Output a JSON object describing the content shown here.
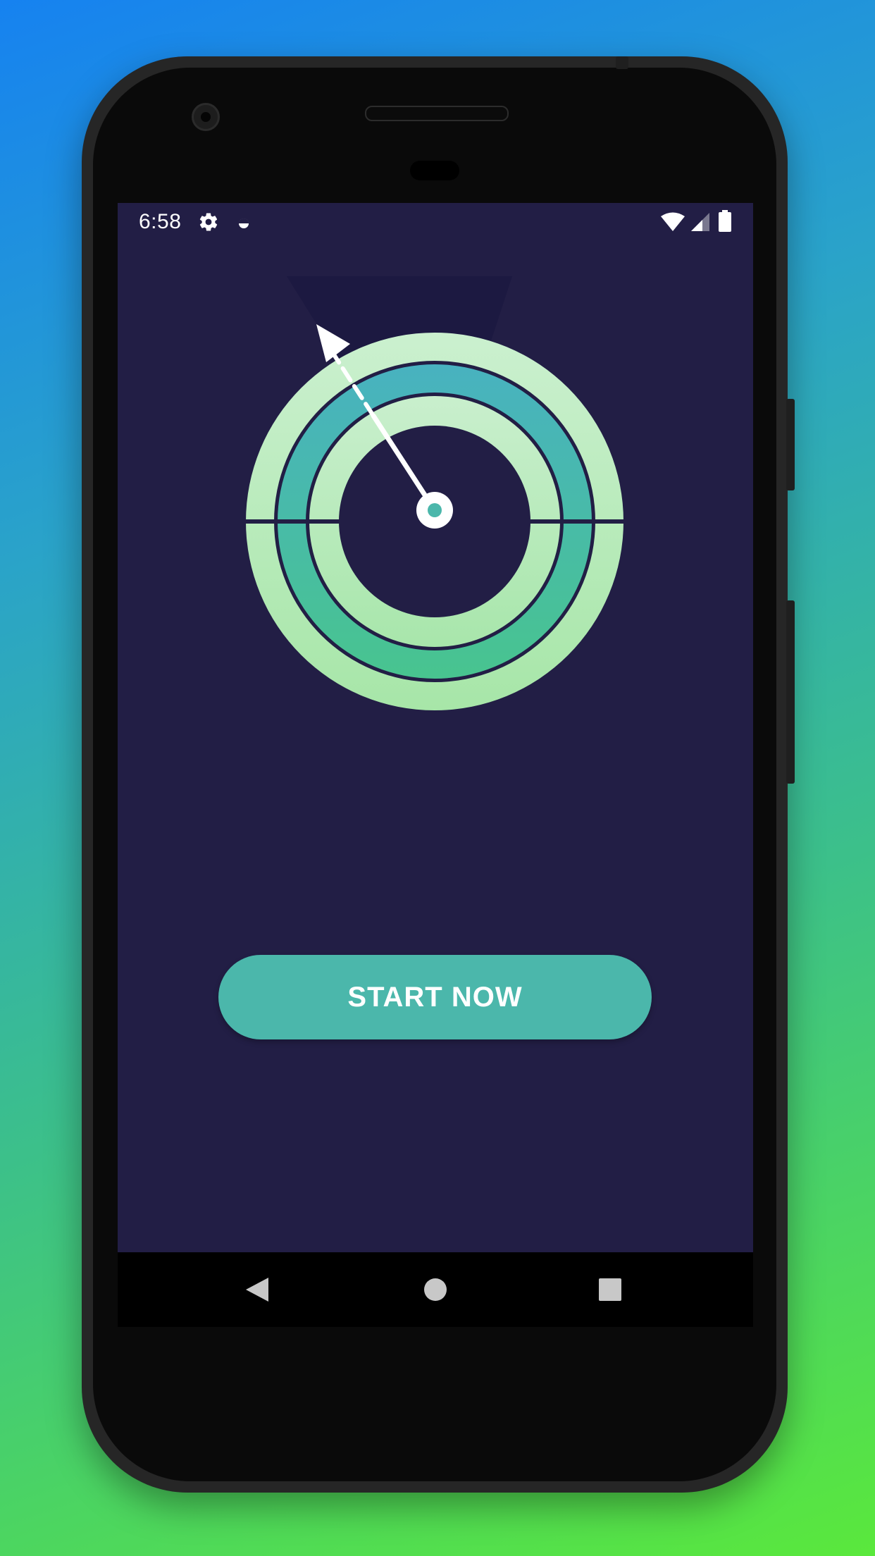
{
  "status_bar": {
    "time": "6:58",
    "icons": [
      "gear-icon",
      "loading-icon",
      "wifi-icon",
      "signal-icon",
      "battery-icon"
    ]
  },
  "main": {
    "start_button_label": "START NOW"
  },
  "nav_bar": {
    "buttons": [
      "back-icon",
      "home-icon",
      "recents-icon"
    ]
  },
  "colors": {
    "screen_background": "#221e45",
    "accent": "#4bb7ab",
    "ring_light": "#c6efcd",
    "ring_mid": "#4bbfa0",
    "needle": "#ffffff"
  }
}
